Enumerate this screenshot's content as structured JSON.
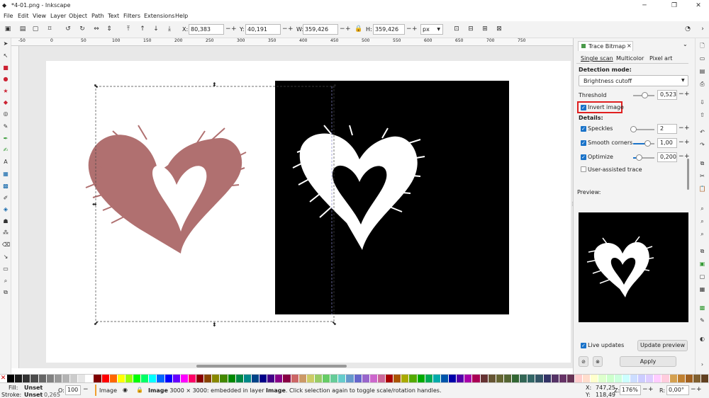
{
  "window": {
    "title": "*4-01.png - Inkscape",
    "minimize": "─",
    "maximize": "❐",
    "close": "✕"
  },
  "menu": [
    "File",
    "Edit",
    "View",
    "Layer",
    "Object",
    "Path",
    "Text",
    "Filters",
    "Extensions",
    "Help"
  ],
  "toolbar": {
    "x_label": "X:",
    "x_value": "80,383",
    "y_label": "Y:",
    "y_value": "40,191",
    "w_label": "W:",
    "w_value": "359,426",
    "h_label": "H:",
    "h_value": "359,426",
    "unit": "px",
    "plus": "+",
    "minus": "−"
  },
  "ruler": {
    "ticks": [
      "-50",
      "0",
      "50",
      "100",
      "150",
      "200",
      "250",
      "300",
      "350",
      "400",
      "450",
      "500",
      "550",
      "600",
      "650",
      "700",
      "750"
    ]
  },
  "panel": {
    "tab_title": "Trace Bitmap",
    "tab_close": "×",
    "subtabs": [
      "Single scan",
      "Multicolor",
      "Pixel art"
    ],
    "detection_mode_label": "Detection mode:",
    "detection_mode_value": "Brightness cutoff",
    "threshold_label": "Threshold",
    "threshold_value": "0,523",
    "threshold_level": 0.523,
    "invert_label": "Invert image",
    "invert_checked": true,
    "details_label": "Details:",
    "speckles_label": "Speckles",
    "speckles_value": "2",
    "smooth_label": "Smooth corners",
    "smooth_value": "1,00",
    "optimize_label": "Optimize",
    "optimize_value": "0,200",
    "user_assisted_label": "User-assisted trace",
    "preview_label": "Preview:",
    "live_updates_label": "Live updates",
    "update_preview_label": "Update preview",
    "apply_label": "Apply"
  },
  "status": {
    "fill_label": "Fill:",
    "fill_value": "Unset",
    "stroke_label": "Stroke:",
    "stroke_value": "Unset",
    "stroke_width": "0,265",
    "opacity_label": "O:",
    "opacity_value": "100",
    "layer_name": "Image",
    "message_bold": "Image",
    "message": "3000 × 3000: embedded in layer",
    "message_layer": "Image",
    "message_tail": ". Click selection again to toggle scale/rotation handles.",
    "x_label": "X:",
    "x_value": "747,25",
    "y_label": "Y:",
    "y_value": "118,49",
    "zoom_label": "Z:",
    "zoom_value": "176%",
    "rotate_label": "R:",
    "rotate_value": "0,00°"
  },
  "colors": {
    "heart": "#b07070",
    "accent": "#1a73c9",
    "highlight": "#e02020"
  }
}
